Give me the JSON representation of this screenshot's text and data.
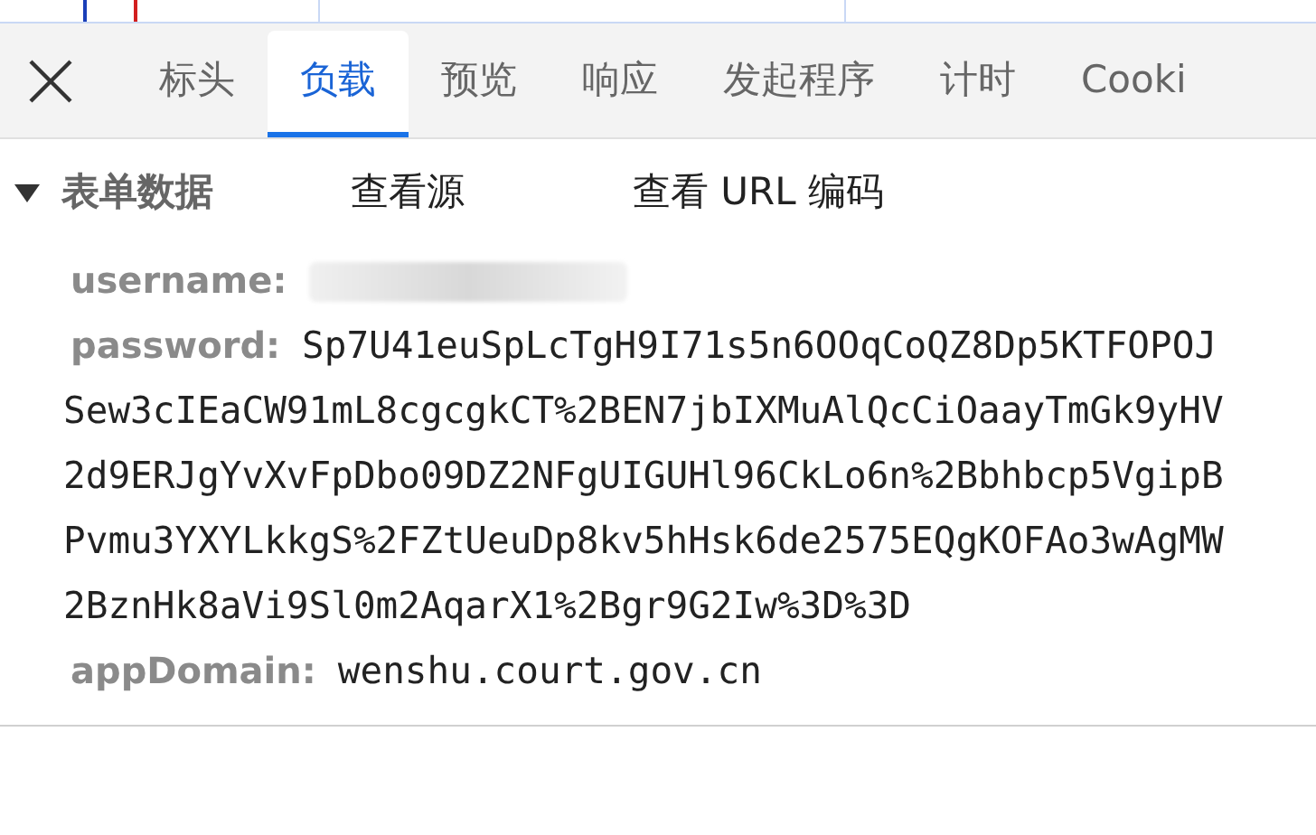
{
  "tabs": [
    {
      "label": "标头",
      "selected": false
    },
    {
      "label": "负载",
      "selected": true
    },
    {
      "label": "预览",
      "selected": false
    },
    {
      "label": "响应",
      "selected": false
    },
    {
      "label": "发起程序",
      "selected": false
    },
    {
      "label": "计时",
      "selected": false
    },
    {
      "label": "Cooki",
      "selected": false
    }
  ],
  "section": {
    "title": "表单数据",
    "expanded": true,
    "links": [
      "查看源",
      "查看 URL 编码"
    ]
  },
  "fields": [
    {
      "name": "username:",
      "kind": "redacted"
    },
    {
      "name": "password:",
      "kind": "text",
      "lines": [
        "Sp7U41euSpLcTgH9I71s5n6OOqCoQZ8Dp5KTFOPOJ",
        "Sew3cIEaCW91mL8cgcgkCT%2BEN7jbIXMuAlQcCiOaayTmGk9yHV",
        "2d9ERJgYvXvFpDbo09DZ2NFgUIGUHl96CkLo6n%2Bbhbcp5VgipB",
        "Pvmu3YXYLkkgS%2FZtUeuDp8kv5hHsk6de2575EQgKOFAo3wAgMW",
        "2BznHk8aVi9Sl0m2AqarX1%2Bgr9G2Iw%3D%3D"
      ]
    },
    {
      "name": "appDomain:",
      "kind": "text",
      "lines": [
        "wenshu.court.gov.cn"
      ]
    }
  ]
}
